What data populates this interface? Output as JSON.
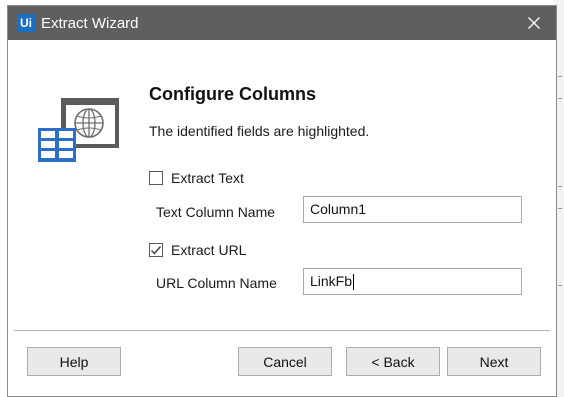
{
  "window": {
    "title": "Extract Wizard",
    "app_logo_text": "Ui"
  },
  "page": {
    "heading": "Configure Columns",
    "description": "The identified fields are highlighted."
  },
  "form": {
    "extract_text": {
      "label": "Extract Text",
      "checked": false
    },
    "text_column": {
      "label": "Text Column Name",
      "value": "Column1"
    },
    "extract_url": {
      "label": "Extract URL",
      "checked": true
    },
    "url_column": {
      "label": "URL Column Name",
      "value": "LinkFb"
    }
  },
  "buttons": {
    "help": "Help",
    "cancel": "Cancel",
    "back": "< Back",
    "next": "Next"
  },
  "colors": {
    "titlebar": "#5f5f5f",
    "logo": "#1c6fc1",
    "icon_blue": "#2b6fc7"
  }
}
